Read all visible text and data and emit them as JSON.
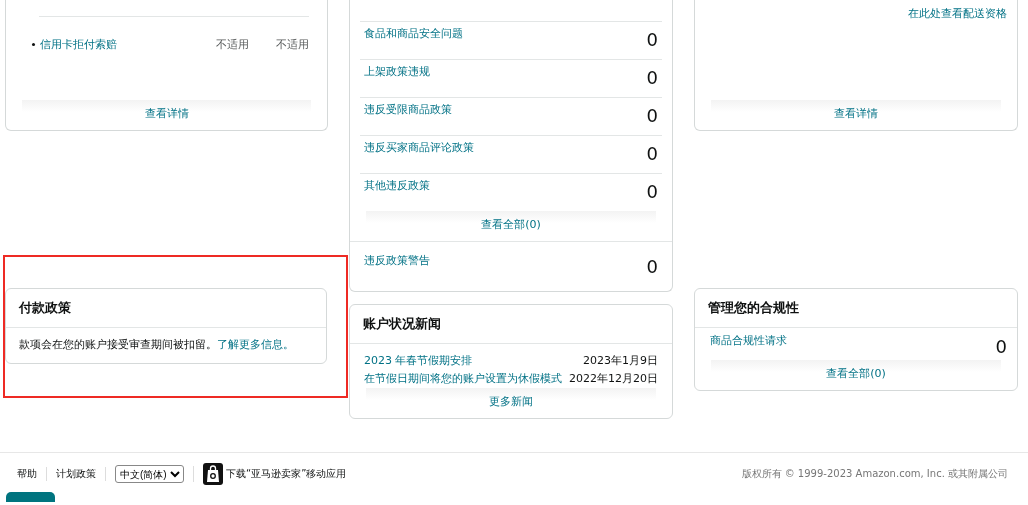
{
  "chargeback_card": {
    "rows": [
      {
        "label": "信用卡拒付索赔",
        "column_2": "不适用",
        "column_3": "不适用"
      }
    ],
    "footer_link": "查看详情"
  },
  "policy_card": {
    "rows": [
      {
        "label": "食品和商品安全问题",
        "count": "0"
      },
      {
        "label": "上架政策违规",
        "count": "0"
      },
      {
        "label": "违反受限商品政策",
        "count": "0"
      },
      {
        "label": "违反买家商品评论政策",
        "count": "0"
      },
      {
        "label": "其他违反政策",
        "count": "0"
      }
    ],
    "footer_link": "查看全部(0)",
    "warning": {
      "label": "违反政策警告",
      "count": "0"
    }
  },
  "shipping_card": {
    "link": "在此处查看配送资格",
    "footer_link": "查看详情"
  },
  "payment_policy": {
    "title": "付款政策",
    "text": "款项会在您的账户接受审查期间被扣留。",
    "link": "了解更多信息。"
  },
  "news": {
    "title": "账户状况新闻",
    "items": [
      {
        "title": "2023 年春节假期安排",
        "date": "2023年1月9日"
      },
      {
        "title": "在节假日期间将您的账户设置为休假模式",
        "date": "2022年12月20日"
      }
    ],
    "more": "更多新闻"
  },
  "compliance": {
    "title": "管理您的合规性",
    "rows": [
      {
        "label": "商品合规性请求",
        "count": "0"
      }
    ],
    "footer_link": "查看全部(0)"
  },
  "footer": {
    "links": [
      "帮助",
      "计划政策"
    ],
    "language": "中文(简体)",
    "app_link": "下载“亚马逊卖家”移动应用",
    "copyright": "版权所有 © 1999-2023 Amazon.com, Inc. 或其附属公司"
  }
}
